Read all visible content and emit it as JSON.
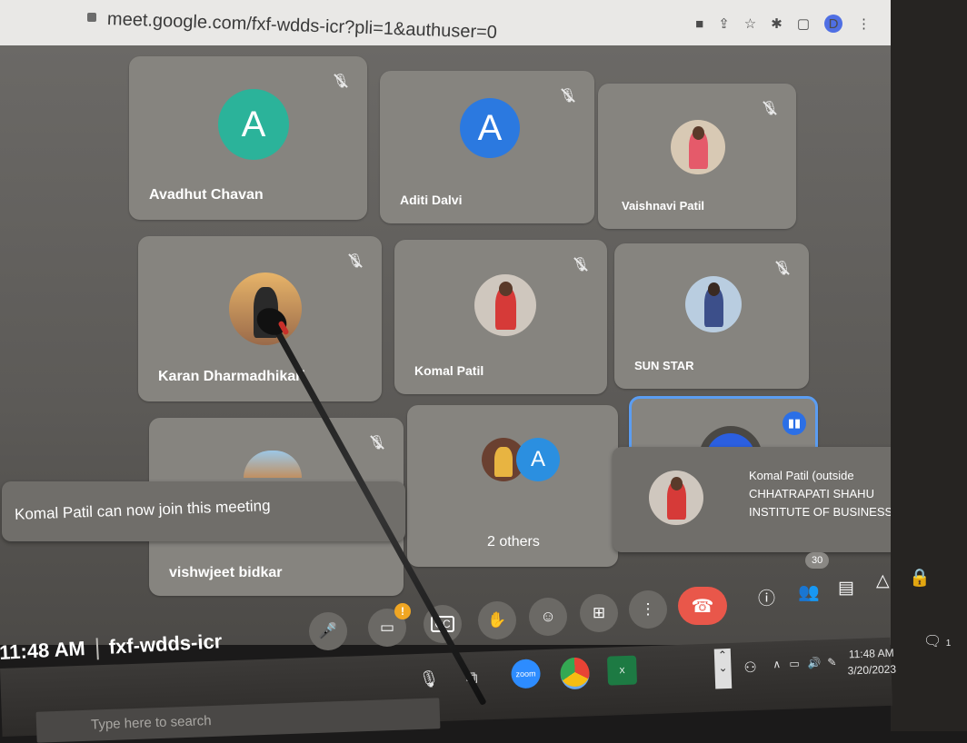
{
  "browser": {
    "url": "meet.google.com/fxf-wdds-icr?pli=1&authuser=0",
    "profile_initial": "D"
  },
  "participants": [
    {
      "name": "Avadhut Chavan",
      "avatar_type": "letter",
      "letter": "A",
      "color": "#2bb39a"
    },
    {
      "name": "Aditi Dalvi",
      "avatar_type": "letter",
      "letter": "A",
      "color": "#2b79e0"
    },
    {
      "name": "Vaishnavi Patil",
      "avatar_type": "photo"
    },
    {
      "name": "Karan Dharmadhikari",
      "avatar_type": "photo"
    },
    {
      "name": "Komal Patil",
      "avatar_type": "photo"
    },
    {
      "name": "SUN STAR",
      "avatar_type": "photo"
    },
    {
      "name": "vishwjeet bidkar",
      "avatar_type": "photo"
    },
    {
      "name": "2 others",
      "avatar_type": "group",
      "letter": "A",
      "color": "#2b8fe0"
    },
    {
      "name": "",
      "avatar_type": "self",
      "speaking": true
    }
  ],
  "notifications": {
    "join": "Komal Patil can now join this meeting",
    "knock_line1": "Komal Patil (outside",
    "knock_line2": "CHHATRAPATI SHAHU",
    "knock_line3": "INSTITUTE OF BUSINESS ..."
  },
  "meeting": {
    "time": "11:48 AM",
    "code": "fxf-wdds-icr",
    "participant_count": "30"
  },
  "controls": {
    "mic_icon": "microphone-icon",
    "camera_icon": "camera-off-icon",
    "captions_label": "CC",
    "hand_icon": "raise-hand-icon",
    "emoji_icon": "emoji-icon",
    "present_icon": "present-screen-icon",
    "more_icon": "more-options-icon",
    "end_icon": "end-call-icon",
    "info_icon": "info-icon",
    "people_icon": "people-icon",
    "chat_icon": "chat-icon",
    "activities_icon": "activities-icon",
    "host_icon": "host-controls-icon",
    "end_color": "#e9574a"
  },
  "taskbar": {
    "search_placeholder": "Type here to search",
    "zoom_label": "zoom",
    "clock_time": "11:48 AM",
    "clock_date": "3/20/2023",
    "notification_count": "1"
  }
}
